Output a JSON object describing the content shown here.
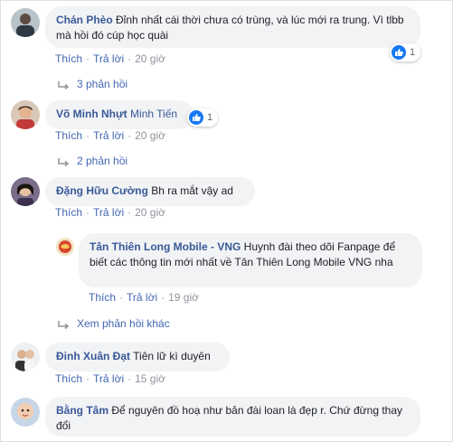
{
  "colors": {
    "link": "#385898",
    "action": "#4267b2",
    "bubble": "#f2f3f5",
    "like_blue": "#1877f2"
  },
  "comments": [
    {
      "author": "Chán Phèo",
      "text": "Đỉnh nhất cái thời chưa có trùng, và lúc mới ra trung. Vì tlbb mà hồi đó cúp học quài",
      "like_label": "Thích",
      "reply_label": "Trả lời",
      "time": "20 giờ",
      "reaction_count": "1",
      "replies_label": "3 phản hồi"
    },
    {
      "author": "Võ Minh Nhựt",
      "tag": "Minh Tiến",
      "like_label": "Thích",
      "reply_label": "Trả lời",
      "time": "20 giờ",
      "reaction_count": "1",
      "replies_label": "2 phản hồi"
    },
    {
      "author": "Đặng Hữu Cường",
      "text": "Bh ra mắt vậy ad",
      "like_label": "Thích",
      "reply_label": "Trả lời",
      "time": "20 giờ",
      "reply": {
        "author": "Tân Thiên Long Mobile - VNG",
        "text": "Huynh đài theo dõi Fanpage để biết các thông tin mới nhất về Tân Thiên Long Mobile VNG nha",
        "like_label": "Thích",
        "reply_label": "Trả lời",
        "time": "19 giờ"
      },
      "more_replies_label": "Xem phản hồi khác"
    },
    {
      "author": "Đinh Xuân Đạt",
      "text": "Tiên lữ kì duyên",
      "like_label": "Thích",
      "reply_label": "Trả lời",
      "time": "15 giờ"
    },
    {
      "author": "Bằng Tâm",
      "text": "Để nguyên đồ hoạ như bản đài loan là đẹp r. Chứ đừng thay đổi"
    }
  ]
}
